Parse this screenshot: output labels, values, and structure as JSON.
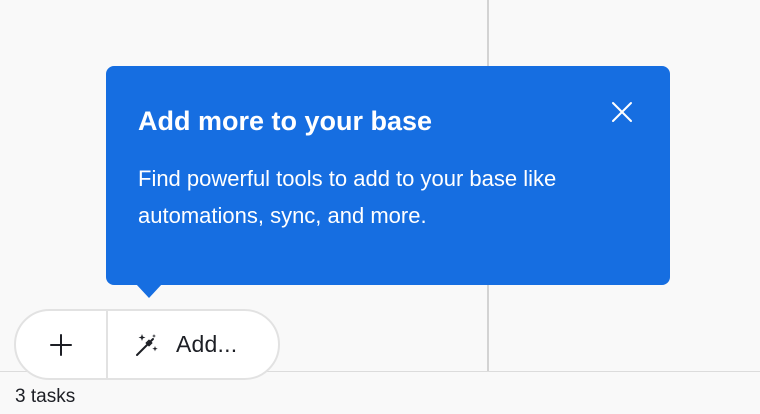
{
  "popover": {
    "title": "Add more to your base",
    "body": "Find powerful tools to add to your base like automations, sync, and more.",
    "close_icon": "close-icon",
    "background_color": "#166ee1"
  },
  "add_bar": {
    "plus_icon": "plus-icon",
    "magic_wand_icon": "magic-wand-icon",
    "add_label": "Add..."
  },
  "footer": {
    "record_count": "3 tasks"
  }
}
